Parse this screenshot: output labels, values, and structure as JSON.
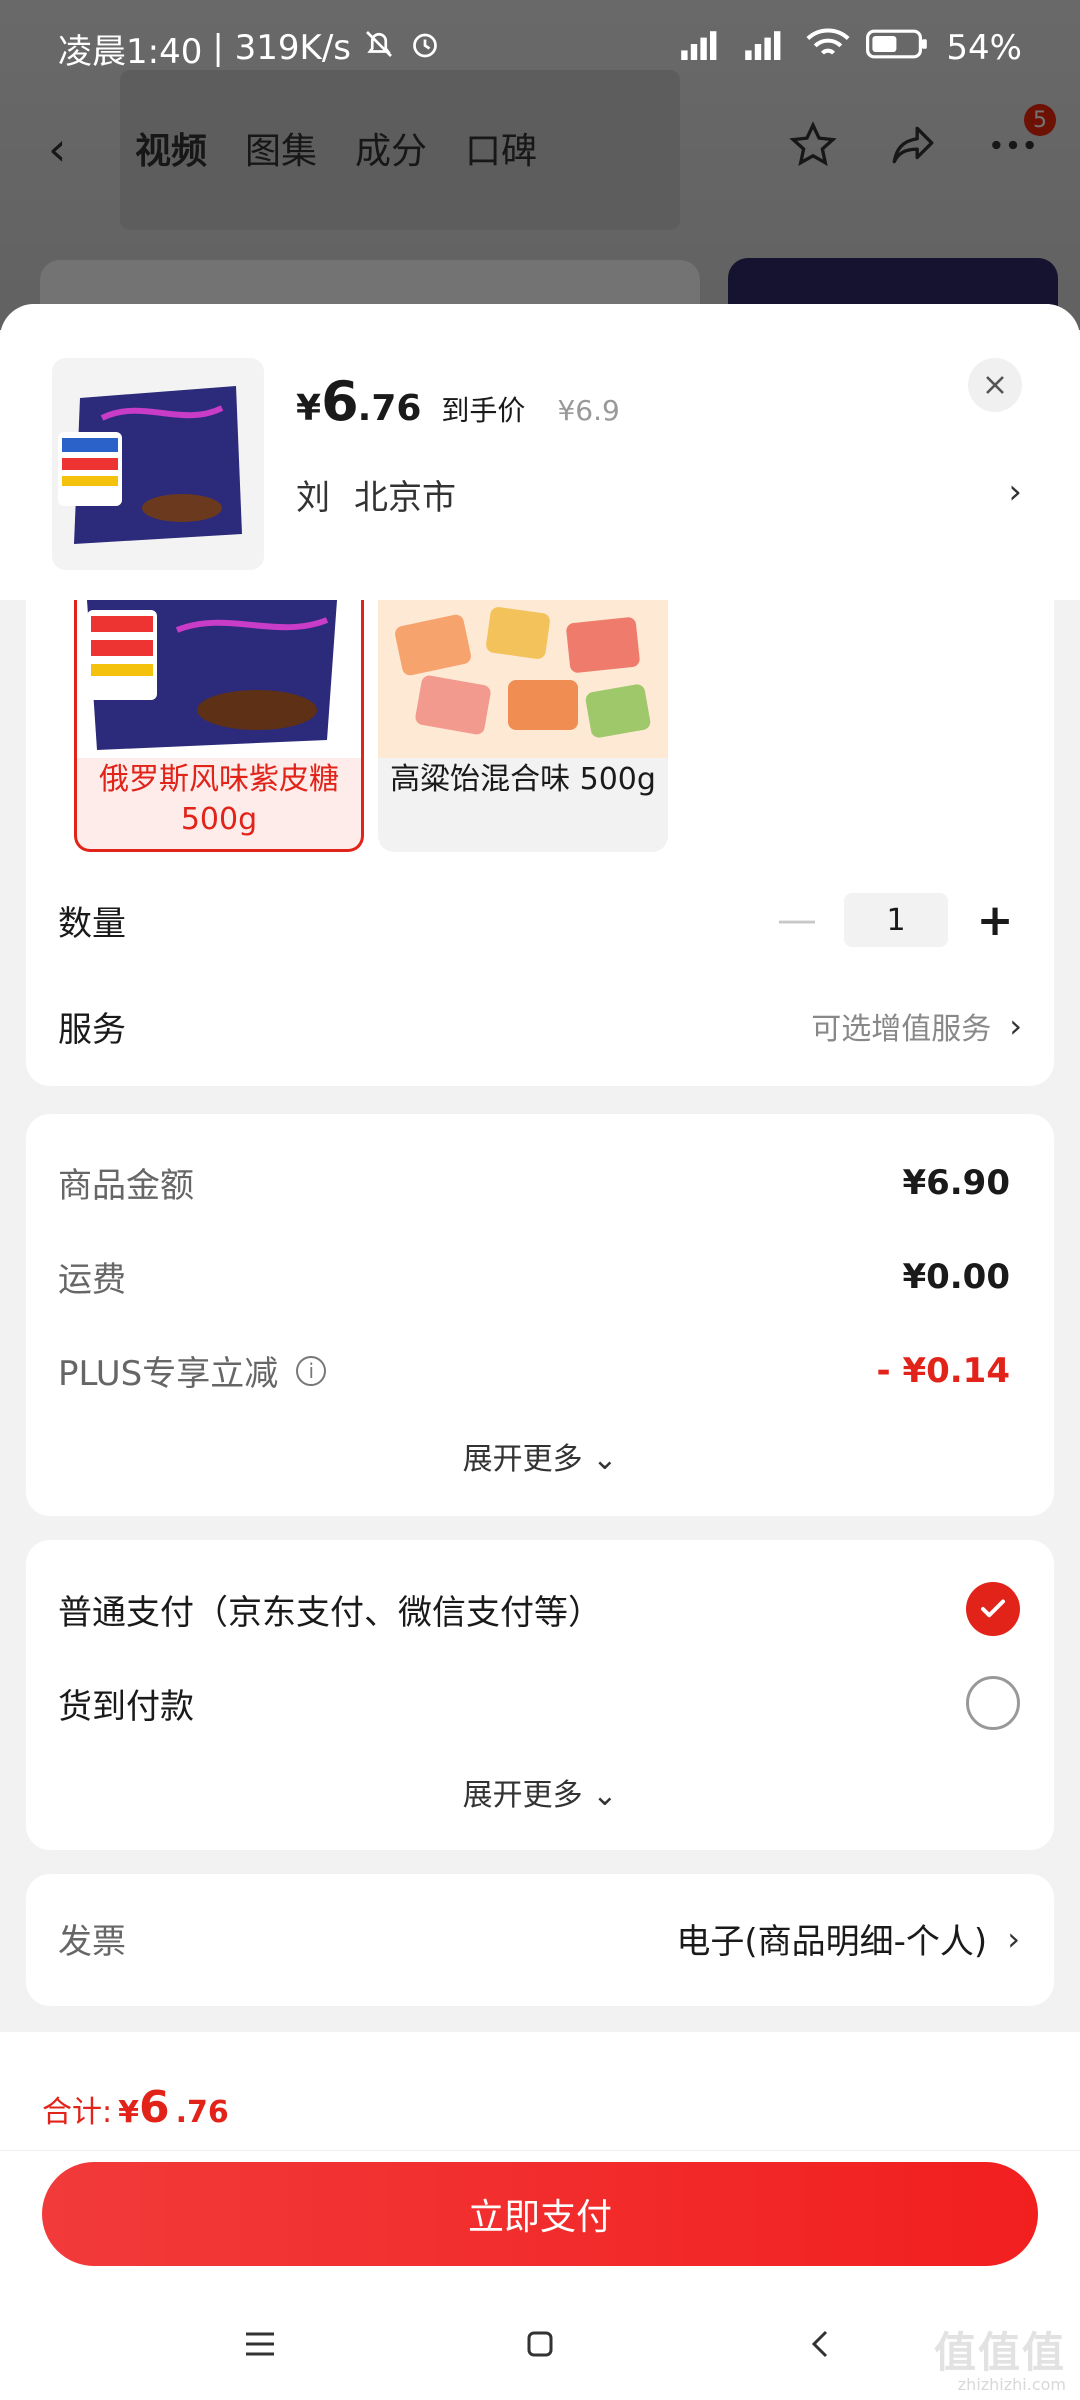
{
  "status_bar": {
    "time": "凌晨1:40",
    "speed": "| 319K/s",
    "battery": "54%"
  },
  "bg_nav": {
    "tabs": [
      "视频",
      "图集",
      "成分",
      "口碑"
    ],
    "badge": "5"
  },
  "product": {
    "price_symbol": "¥",
    "price_int": "6",
    "price_dec": ".76",
    "price_label": "到手价",
    "original_price": "¥6.9",
    "recipient": "刘",
    "city": "北京市"
  },
  "specs": [
    {
      "label": "俄罗斯风味紫皮糖 500g",
      "selected": true
    },
    {
      "label": "高粱饴混合味 500g",
      "selected": false
    }
  ],
  "quantity": {
    "label": "数量",
    "value": "1"
  },
  "service": {
    "label": "服务",
    "value": "可选增值服务"
  },
  "costs": {
    "rows": [
      {
        "label": "商品金额",
        "value": "¥6.90"
      },
      {
        "label": "运费",
        "value": "¥0.00"
      },
      {
        "label": "PLUS专享立减",
        "value": "- ¥0.14"
      }
    ],
    "expand": "展开更多"
  },
  "payment": {
    "options": [
      {
        "label": "普通支付（京东支付、微信支付等）",
        "selected": true
      },
      {
        "label": "货到付款",
        "selected": false
      }
    ],
    "expand": "展开更多"
  },
  "invoice": {
    "label": "发票",
    "value": "电子(商品明细-个人)"
  },
  "footer": {
    "total_label": "合计:",
    "total_yen": "¥",
    "total_int": "6",
    "total_dec": ".76",
    "pay_button": "立即支付"
  },
  "watermark": {
    "main": "值值值",
    "sub": "zhizhizhi.com"
  },
  "colors": {
    "accent": "#e2231a",
    "button": "#f2270c",
    "background": "#f2f2f2"
  }
}
